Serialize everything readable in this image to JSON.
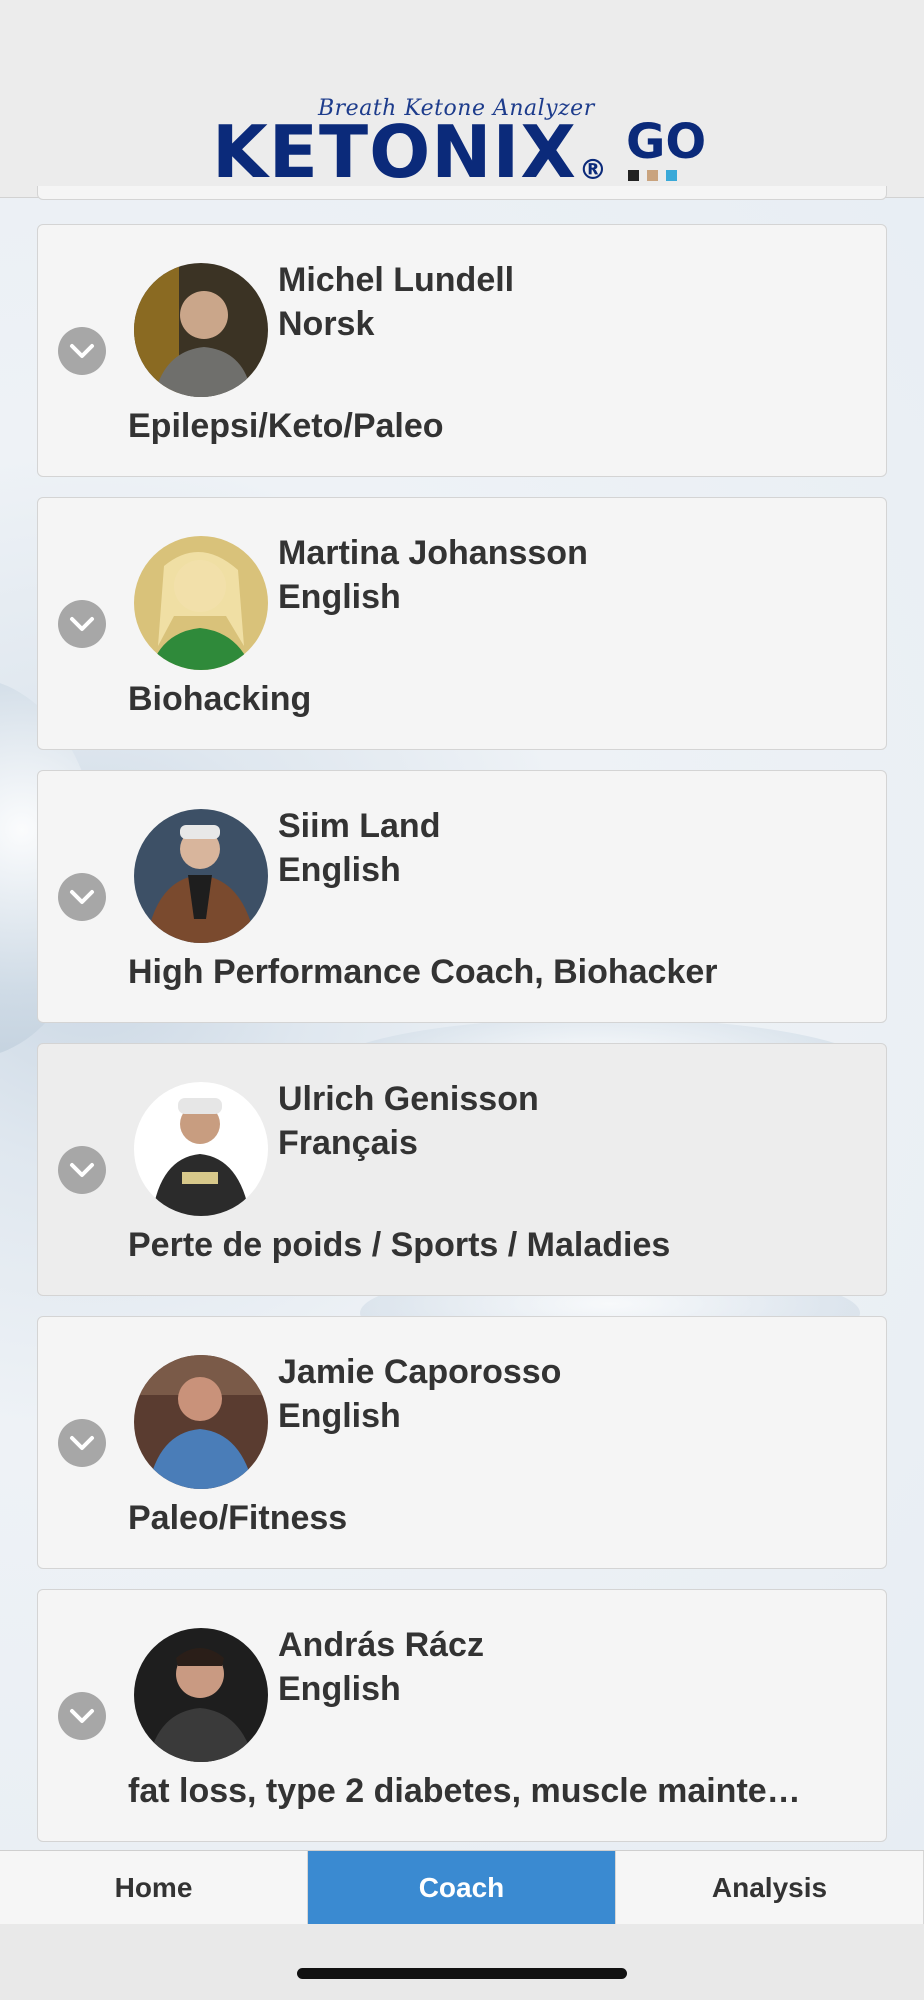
{
  "header": {
    "tagline": "Breath Ketone Analyzer",
    "brand": "KETONIX",
    "registered": "®",
    "suffix": "GO",
    "dot_colors": [
      "#222222",
      "#c9a37e",
      "#3aa9d8"
    ]
  },
  "coaches": [
    {
      "name": "Michel Lundell",
      "language": "Norsk",
      "topic": "Epilepsi/Keto/Paleo",
      "highlighted": false
    },
    {
      "name": "Martina Johansson",
      "language": "English",
      "topic": "Biohacking",
      "highlighted": false
    },
    {
      "name": "Siim Land",
      "language": "English",
      "topic": "High Performance Coach, Biohacker",
      "highlighted": false
    },
    {
      "name": "Ulrich Genisson",
      "language": "Français",
      "topic": "Perte de poids / Sports / Maladies",
      "highlighted": true
    },
    {
      "name": "Jamie Caporosso",
      "language": "English",
      "topic": "Paleo/Fitness",
      "highlighted": false
    },
    {
      "name": "András Rácz",
      "language": "English",
      "topic": "fat loss, type 2 diabetes, muscle mainte…",
      "highlighted": false
    }
  ],
  "tabs": {
    "home": "Home",
    "coach": "Coach",
    "analysis": "Analysis",
    "active": "Coach",
    "active_color": "#3a8ad1"
  }
}
